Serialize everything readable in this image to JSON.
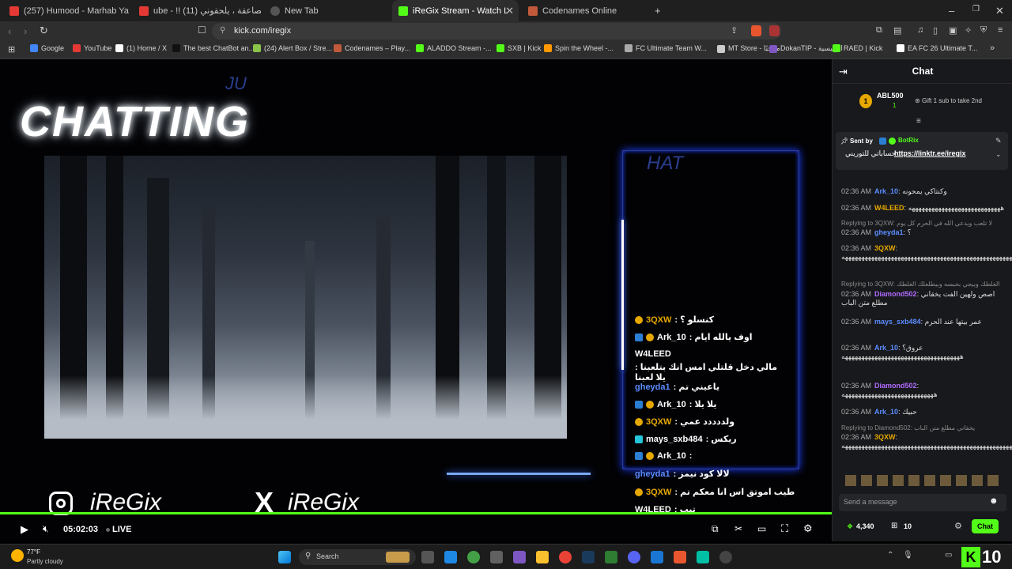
{
  "tabs": [
    {
      "label": "(257) Humood - Marhab Ya Hilal | لل",
      "color": "#e53935"
    },
    {
      "label": "ube - !! مدربين الصاعقة ، يلحقوني (11)",
      "color": "#e53935"
    },
    {
      "label": "New Tab",
      "color": "#9e9e9e"
    },
    {
      "label": "iReGix Stream - Watch Live on K",
      "color": "#53fc18"
    },
    {
      "label": "Codenames Online",
      "color": "#c05a3a"
    }
  ],
  "url": "kick.com/iregix",
  "bookmarks": [
    {
      "label": "Google",
      "color": "#4285f4"
    },
    {
      "label": "YouTube",
      "color": "#e53935"
    },
    {
      "label": "(1) Home / X",
      "color": "#ffffff"
    },
    {
      "label": "The best ChatBot an...",
      "color": "#111111"
    },
    {
      "label": "(24) Alert Box / Stre...",
      "color": "#8bc34a"
    },
    {
      "label": "Codenames – Play...",
      "color": "#c05a3a"
    },
    {
      "label": "ALADDO Stream -...",
      "color": "#53fc18"
    },
    {
      "label": "SXB | Kick",
      "color": "#53fc18"
    },
    {
      "label": "Spin the Wheel -...",
      "color": "#ff9800"
    },
    {
      "label": "FC Ultimate Team W...",
      "color": "#aaaaaa"
    },
    {
      "label": "MT Store - مرحبًا",
      "color": "#cccccc"
    },
    {
      "label": "DokanTIP - الرئيسية",
      "color": "#7e57c2"
    },
    {
      "label": "RAED | Kick",
      "color": "#53fc18"
    },
    {
      "label": "EA FC 26 Ultimate T...",
      "color": "#ffffff"
    }
  ],
  "stream": {
    "title_overlay": "CHATTING",
    "logo_small": "JU",
    "hat_text": "HAT",
    "instagram": "iReGix",
    "x_handle": "iReGix",
    "overlay_chat": [
      {
        "user": "3QXW",
        "text": ": كنسلو ؟",
        "badges": "o",
        "color": "#e6a800"
      },
      {
        "user": "Ark_10",
        "text": ": اوف يالله ايام",
        "badges": "bo",
        "color": "#ffffff"
      },
      {
        "user": "W4LEED",
        "text": ": مالي دخل قلتلي امس انك بتلعبنا يلا لعبنا",
        "badges": "",
        "color": "#ffffff"
      },
      {
        "user": "gheyda1",
        "text": ": ياعيني تم",
        "badges": "",
        "color": "#5b8cff"
      },
      {
        "user": "Ark_10",
        "text": ": يلا يلا",
        "badges": "bo",
        "color": "#ffffff"
      },
      {
        "user": "3QXW",
        "text": ": ولددددد عمي",
        "badges": "o",
        "color": "#e6a800"
      },
      {
        "user": "mays_sxb484",
        "text": ": ريكس",
        "badges": "g",
        "color": "#ffffff"
      },
      {
        "user": "Ark_10",
        "text": ":",
        "badges": "bo",
        "color": "#ffffff"
      },
      {
        "user": "gheyda1",
        "text": ": لالا كود نيمز",
        "badges": "",
        "color": "#5b8cff"
      },
      {
        "user": "3QXW",
        "text": ": طيب اموتق اس انا معكم تم",
        "badges": "o",
        "color": "#e6a800"
      },
      {
        "user": "W4LEED",
        "text": ": تيب",
        "badges": "",
        "color": "#ffffff"
      }
    ]
  },
  "player": {
    "time": "05:02:03",
    "live_label": "LIVE"
  },
  "chat": {
    "header": "Chat",
    "top_gifter": "ABL500",
    "top_gifter_count": "1",
    "gift_prompt": "Gift 1 sub to take 2nd",
    "pinned_sent_by": "Sent by",
    "pinned_user": "BotRix",
    "pinned_text": "حساباتي للتوريني :",
    "pinned_link": "https://linktr.ee/iregix",
    "messages": [
      {
        "time": "02:36 AM",
        "user": "Ark_10",
        "text": ": وكنتاكي يمحونه",
        "color": "#5b8cff"
      },
      {
        "time": "02:36 AM",
        "user": "W4LEED",
        "text": ": ههههههههههههههههههههههههههههه",
        "color": "#e6a800"
      },
      {
        "time": "02:36 AM",
        "user": "gheyda1",
        "text": ": ؟",
        "color": "#5b8cff"
      },
      {
        "time": "02:36 AM",
        "user": "3QXW",
        "text": ": ههههههههههههههههههههههههههههههههههههههههههههههههههههههههه",
        "color": "#e6a800"
      },
      {
        "time": "02:36 AM",
        "user": "Diamond502",
        "text": ": اصص ولهين الفت يخقاني مطلع متن الباب",
        "color": "#b06cff"
      },
      {
        "time": "02:36 AM",
        "user": "mays_sxb484",
        "text": ": عمر بيتها عند الحرم",
        "color": "#5b8cff"
      },
      {
        "time": "02:36 AM",
        "user": "Ark_10",
        "text": ": عروق؟ ههههههههههههههههههههههههههههههههههههه",
        "color": "#5b8cff"
      },
      {
        "time": "02:36 AM",
        "user": "Diamond502",
        "text": ": ههههههههههههههههههههههههههههه",
        "color": "#b06cff"
      },
      {
        "time": "02:36 AM",
        "user": "Ark_10",
        "text": ": حبيك",
        "color": "#5b8cff"
      },
      {
        "time": "02:36 AM",
        "user": "3QXW",
        "text": ": ههههههههههههههههههههههههههههههههههههههههههههههههههههههههه",
        "color": "#e6a800"
      }
    ],
    "replies": [
      "Replying to 3QXW: لا تلعب ويدعي الله في الحرم كل يوم",
      "Replying to 3QXW: الغلطك وبيجي بحبسه وبيطلعلك الغلطك",
      "Replying to Diamond502: يخقاني مطلع متن الباب"
    ],
    "input_placeholder": "Send a message",
    "points": "4,340",
    "gift_count": "10",
    "send_label": "Chat"
  },
  "taskbar": {
    "weather_temp": "77°F",
    "weather_desc": "Partly cloudy",
    "search_label": "Search",
    "kick_count": "10"
  }
}
